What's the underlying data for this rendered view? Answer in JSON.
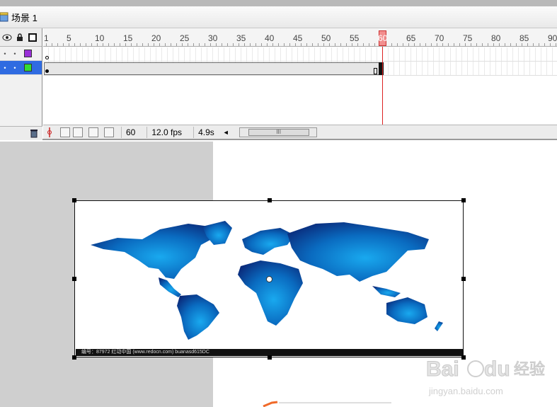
{
  "scene": {
    "label": "场景 1"
  },
  "timeline": {
    "ruler_numbers": [
      "1",
      "5",
      "10",
      "15",
      "20",
      "25",
      "30",
      "35",
      "40",
      "45",
      "50",
      "55",
      "60",
      "65",
      "70",
      "75",
      "80",
      "85",
      "90"
    ],
    "current_frame": "60",
    "frame_rate": "12.0 fps",
    "elapsed_time": "4.9s",
    "layers": [
      {
        "color": "#9a30d8",
        "selected": false
      },
      {
        "color": "#33dd33",
        "selected": true
      }
    ],
    "scroll_thumb": "III"
  },
  "stage": {
    "caption": "编号：87972  红动中国 (www.redocn.com)  buanasd615DC"
  },
  "watermark": {
    "brand": "Baidu 经验",
    "url": "jingyan.baidu.com"
  },
  "colors": {
    "selection": "#2f6be1",
    "playhead": "#d22222",
    "map_dark": "#0a2a7a",
    "map_light": "#1aa0e8"
  }
}
